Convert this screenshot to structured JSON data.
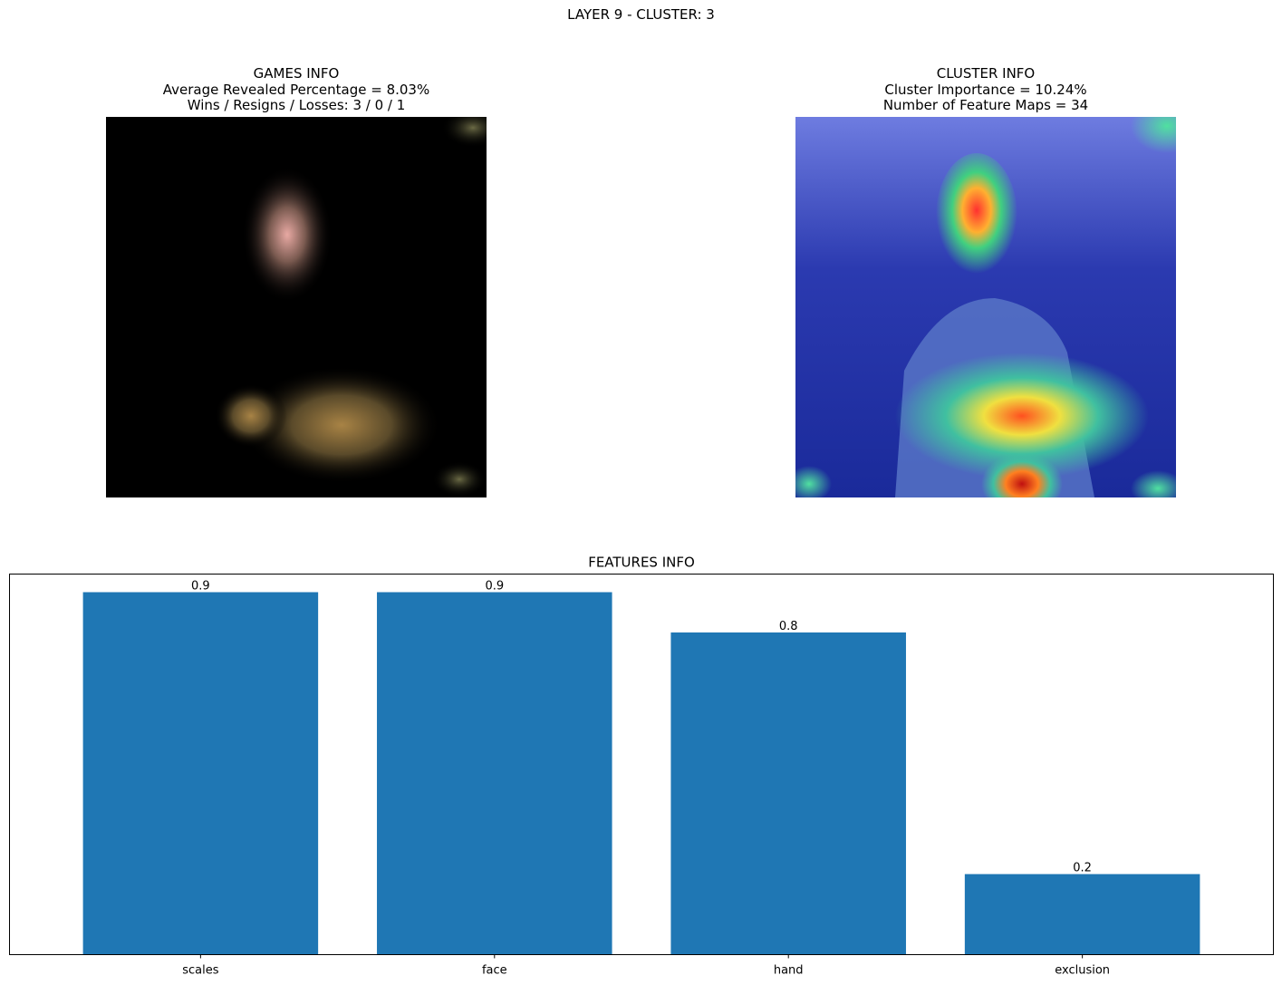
{
  "figure": {
    "title": "LAYER 9 - CLUSTER: 3"
  },
  "games_panel": {
    "title_lines": [
      "GAMES INFO",
      "Average Revealed Percentage = 8.03%",
      "Wins / Resigns / Losses: 3 / 0 / 1"
    ]
  },
  "cluster_panel": {
    "title_lines": [
      "CLUSTER INFO",
      "Cluster Importance = 10.24%",
      "Number of Feature Maps = 34"
    ]
  },
  "chart_data": {
    "type": "bar",
    "title": "FEATURES INFO",
    "categories": [
      "scales",
      "face",
      "hand",
      "exclusion"
    ],
    "values": [
      0.9,
      0.9,
      0.8,
      0.2
    ],
    "data_labels": [
      "0.9",
      "0.9",
      "0.8",
      "0.2"
    ],
    "xlabel": "",
    "ylabel": "",
    "ylim": [
      0,
      0.945
    ],
    "yaxis_visible": false,
    "grid": false,
    "color": "#1f77b4"
  }
}
